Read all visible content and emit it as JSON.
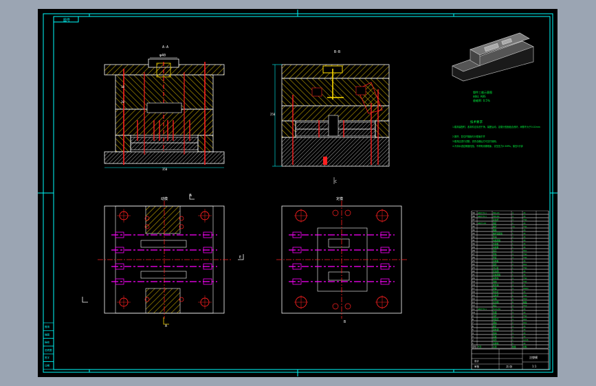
{
  "drawing": {
    "frame_tag": "图号",
    "section_a_label": "A-A",
    "section_b_label": "B-B",
    "top_view_label": "动模",
    "right_view_label": "定模",
    "dim_label_top": "φ40",
    "cut_marker_a": "A",
    "cut_marker_b": "B",
    "cut_marker_c": "C",
    "cut_marker_e": "E"
  },
  "part_iso": {
    "caption_line1": "塑件三维示意图",
    "caption_line2": "材料: ABS",
    "caption_line3": "收缩率: 0.5%"
  },
  "tech_notes": {
    "title": "技术要求",
    "lines": [
      "1.模具装配时，各零件应清洗干净，装配后动、定模分型面贴合良好，间隙不大于0.02mm",
      "2.推杆、复位杆端面与分型面平齐",
      "3.模具应进行试模，试件合格后方可交付使用。",
      "4.冷却水道应畅通无阻，不得有渗漏现象，试压压力0.5MPa，保压5分钟"
    ]
  },
  "bom": {
    "rows": [
      [
        "39",
        "GB/T70.1",
        "M6x20",
        "4",
        "45"
      ],
      [
        "38",
        "GB/T70.1",
        "M8x60",
        "4",
        "45"
      ],
      [
        "37",
        "",
        "复位杆",
        "4",
        "T8A"
      ],
      [
        "36",
        "GB/T119",
        "销钉",
        "2",
        "45"
      ],
      [
        "35",
        "",
        "推杆",
        "16",
        "T8A"
      ],
      [
        "34",
        "",
        "推板",
        "1",
        "45"
      ],
      [
        "33",
        "",
        "推杆固定板",
        "1",
        "45"
      ],
      [
        "32",
        "",
        "垫块",
        "2",
        "45"
      ],
      [
        "31",
        "",
        "动模座板",
        "1",
        "45"
      ],
      [
        "30",
        "",
        "支承板",
        "1",
        "45"
      ],
      [
        "29",
        "",
        "动模板",
        "1",
        "45"
      ],
      [
        "28",
        "",
        "型芯",
        "2",
        "P20"
      ],
      [
        "27",
        "",
        "导柱",
        "4",
        "T8A"
      ],
      [
        "26",
        "",
        "导套",
        "4",
        "T8A"
      ],
      [
        "25",
        "",
        "定模板",
        "1",
        "45"
      ],
      [
        "24",
        "",
        "型腔",
        "2",
        "P20"
      ],
      [
        "23",
        "",
        "浇口套",
        "1",
        "T8A"
      ],
      [
        "22",
        "",
        "定位圈",
        "1",
        "45"
      ],
      [
        "21",
        "",
        "定模座板",
        "1",
        "45"
      ],
      [
        "20",
        "",
        "斜导柱",
        "4",
        "T8A"
      ],
      [
        "19",
        "",
        "滑块",
        "4",
        "T8A"
      ],
      [
        "18",
        "",
        "楔紧块",
        "4",
        "45"
      ],
      [
        "17",
        "",
        "弹簧",
        "4",
        "65Mn"
      ],
      [
        "16",
        "",
        "限位钉",
        "4",
        "45"
      ],
      [
        "15",
        "",
        "拉料杆",
        "1",
        "T8A"
      ],
      [
        "14",
        "",
        "水嘴",
        "8",
        "H62"
      ],
      [
        "13",
        "",
        "密封圈",
        "8",
        "橡胶"
      ],
      [
        "12",
        "",
        "堵头",
        "4",
        "H62"
      ],
      [
        "11",
        "GB/T70.1",
        "M10x30",
        "6",
        "45"
      ],
      [
        "10",
        "",
        "垫圈",
        "4",
        "45"
      ],
      [
        "9",
        "",
        "顶杆",
        "4",
        "T8A"
      ],
      [
        "8",
        "",
        "侧型芯",
        "4",
        "P20"
      ],
      [
        "7",
        "",
        "镶块",
        "2",
        "P20"
      ],
      [
        "6",
        "",
        "螺钉",
        "4",
        "45"
      ],
      [
        "5",
        "",
        "圆柱销",
        "2",
        "45"
      ],
      [
        "4",
        "",
        "挡块",
        "4",
        "45"
      ],
      [
        "3",
        "",
        "压板",
        "4",
        "45"
      ],
      [
        "2",
        "",
        "吊环",
        "1",
        "Q235"
      ],
      [
        "1",
        "",
        "支撑柱",
        "2",
        "45"
      ]
    ],
    "header": [
      "序号",
      "代号",
      "名称",
      "数量",
      "材料"
    ]
  },
  "title_block": {
    "drawing_title": "注塑模",
    "scale": "1:1",
    "sheet": "共1张",
    "designer": "设计",
    "checker": "审核"
  },
  "left_strip": {
    "cells": [
      "借用",
      "描图",
      "描校",
      "旧底图",
      "签字",
      "日期"
    ]
  },
  "colors": {
    "background": "#000000",
    "frame": "#00ffff",
    "outline": "#ffffff",
    "hatch": "#c8a800",
    "centerline": "#ff2020",
    "pin": "#ff00ff",
    "text": "#00ff40",
    "window_bg": "#9ba5b3"
  }
}
